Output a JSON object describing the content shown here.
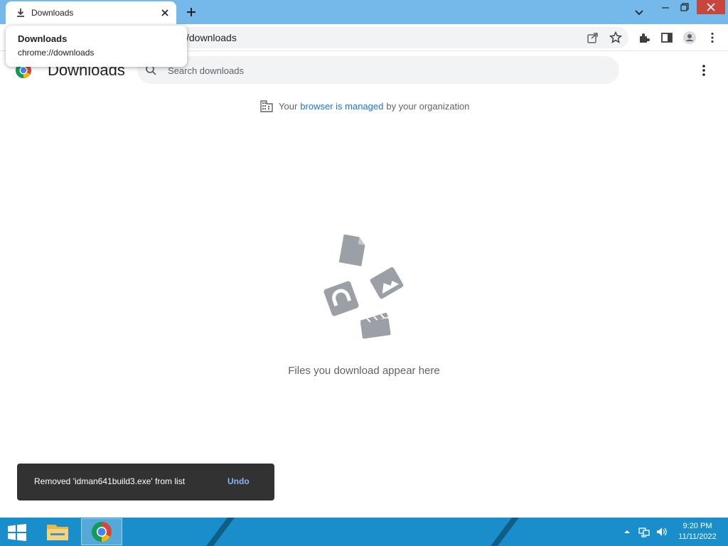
{
  "tab": {
    "title": "Downloads"
  },
  "tooltip": {
    "title": "Downloads",
    "url": "chrome://downloads"
  },
  "toolbar": {
    "url_visible": "/downloads"
  },
  "page": {
    "title": "Downloads",
    "search_placeholder": "Search downloads",
    "managed_prefix": "Your",
    "managed_link": "browser is managed",
    "managed_suffix": "by your organization",
    "empty_message": "Files you download appear here"
  },
  "toast": {
    "message": "Removed 'idman641build3.exe' from list",
    "action": "Undo"
  },
  "taskbar": {
    "time": "9:20 PM",
    "date": "11/11/2022"
  },
  "colors": {
    "titlebar": "#74b9e9",
    "taskbar": "#1a8ecb",
    "link": "#1a73e8",
    "toast_bg": "#323232",
    "close_button": "#c7463e"
  },
  "icons": [
    "download-icon",
    "close-icon",
    "plus-icon",
    "chevron-down-icon",
    "minimize-icon",
    "restore-icon",
    "share-icon",
    "star-icon",
    "extensions-icon",
    "side-panel-icon",
    "profile-icon",
    "more-vert-icon",
    "chrome-logo-icon",
    "search-icon",
    "building-icon",
    "windows-start-icon",
    "file-explorer-icon",
    "chrome-icon"
  ]
}
